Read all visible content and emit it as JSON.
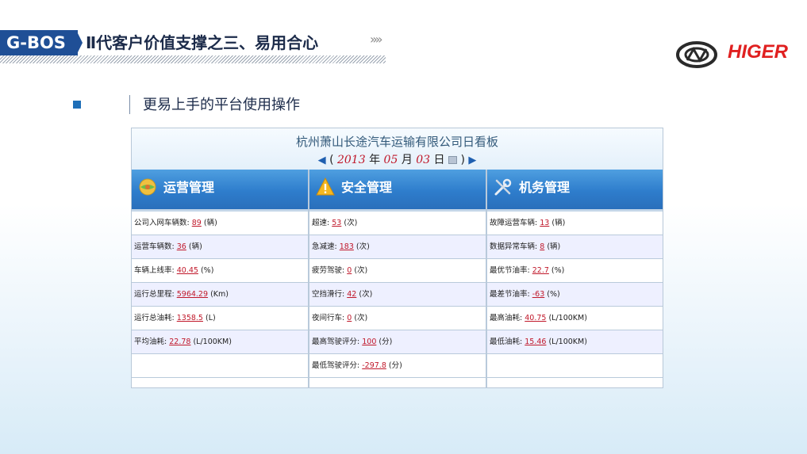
{
  "header": {
    "brand": "G-BOS",
    "title": "Ⅱ代客户价值支撑之三、易用合心",
    "chevrons": "»»",
    "logo_text": "HIGER"
  },
  "section": {
    "subtitle": "更易上手的平台使用操作"
  },
  "board": {
    "title": "杭州萧山长途汽车运输有限公司日看板",
    "date": {
      "open_paren": "(",
      "year": "2013",
      "year_unit": "年",
      "month": "05",
      "month_unit": "月",
      "day": "03",
      "day_unit": "日",
      "close_paren": ")"
    },
    "columns": [
      {
        "title": "运营管理",
        "icon": "globe-icon",
        "rows": [
          {
            "label": "公司入网车辆数:",
            "value": "89",
            "unit": "(辆)"
          },
          {
            "label": "运营车辆数:",
            "value": "36",
            "unit": "(辆)"
          },
          {
            "label": "车辆上线率:",
            "value": "40.45",
            "unit": "(%)"
          },
          {
            "label": "运行总里程:",
            "value": "5964.29",
            "unit": "(Km)"
          },
          {
            "label": "运行总油耗:",
            "value": "1358.5",
            "unit": "(L)"
          },
          {
            "label": "平均油耗:",
            "value": "22.78",
            "unit": "(L/100KM)"
          },
          {
            "label": "",
            "value": "",
            "unit": ""
          }
        ]
      },
      {
        "title": "安全管理",
        "icon": "warning-icon",
        "rows": [
          {
            "label": "超速:",
            "value": "53",
            "unit": "(次)"
          },
          {
            "label": "急减速:",
            "value": "183",
            "unit": "(次)"
          },
          {
            "label": "疲劳驾驶:",
            "value": "0",
            "unit": "(次)"
          },
          {
            "label": "空挡滑行:",
            "value": "42",
            "unit": "(次)"
          },
          {
            "label": "夜间行车:",
            "value": "0",
            "unit": "(次)"
          },
          {
            "label": "最高驾驶评分:",
            "value": "100",
            "unit": "(分)"
          },
          {
            "label": "最低驾驶评分:",
            "value": "-297.8",
            "unit": "(分)"
          }
        ]
      },
      {
        "title": "机务管理",
        "icon": "tools-icon",
        "rows": [
          {
            "label": "故障运营车辆:",
            "value": "13",
            "unit": "(辆)"
          },
          {
            "label": "数据异常车辆:",
            "value": "8",
            "unit": "(辆)"
          },
          {
            "label": "最优节油率:",
            "value": "22.7",
            "unit": "(%)"
          },
          {
            "label": "最差节油率:",
            "value": "-63",
            "unit": "(%)"
          },
          {
            "label": "最高油耗:",
            "value": "40.75",
            "unit": "(L/100KM)"
          },
          {
            "label": "最低油耗:",
            "value": "15.46",
            "unit": "(L/100KM)"
          },
          {
            "label": "",
            "value": "",
            "unit": ""
          }
        ]
      }
    ]
  },
  "colors": {
    "brand_blue": "#1f4f96",
    "value_red": "#c0182a",
    "header_blue": "#2e7dcc",
    "logo_red": "#e02020"
  }
}
